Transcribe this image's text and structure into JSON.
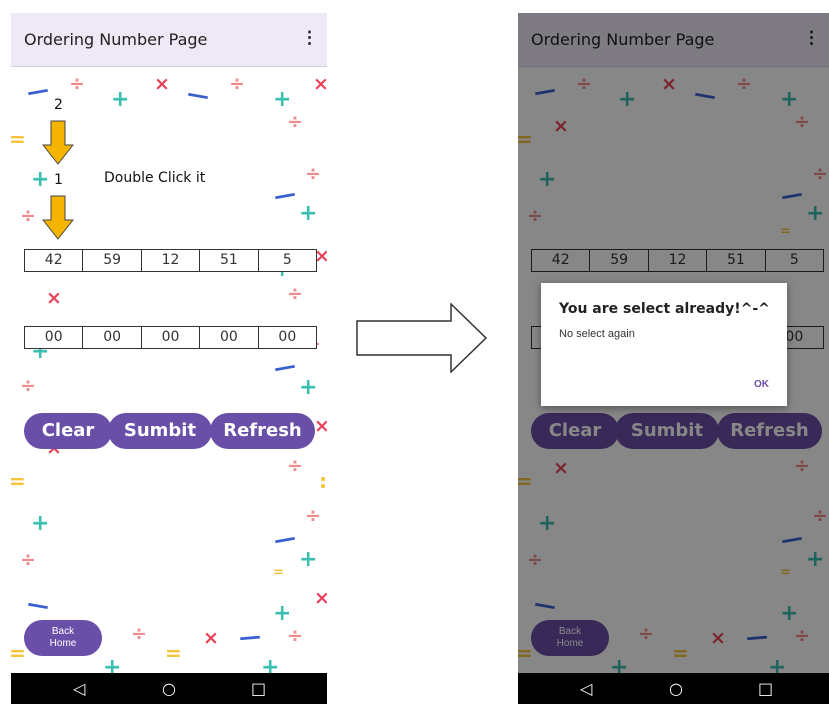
{
  "app": {
    "title": "Ordering Number Page",
    "menu_icon": "more-vert-icon",
    "menu_glyph": "⋮"
  },
  "numbers_row": [
    "42",
    "59",
    "12",
    "51",
    "5"
  ],
  "answer_row": [
    "00",
    "00",
    "00",
    "00",
    "00"
  ],
  "buttons": {
    "clear": "Clear",
    "submit": "Sumbit",
    "refresh": "Refresh",
    "back_line1": "Back",
    "back_line2": "Home"
  },
  "annotations": {
    "step2": "2",
    "step1": "1",
    "instruction": "Double Click it"
  },
  "dialog": {
    "title": "You are select already!^-^",
    "message": "No select again",
    "ok": "OK"
  },
  "nav": {
    "back_glyph": "◁",
    "home_glyph": "○",
    "recent_glyph": "□"
  },
  "colors": {
    "accent": "#6a4fa8",
    "appbar": "#efe8f6",
    "arrow": "#f5b400",
    "plus": "#3bbfb0",
    "times": "#e8435a",
    "divide": "#f08b8b",
    "equals": "#f6c33a",
    "minus": "#3a5fd0"
  }
}
